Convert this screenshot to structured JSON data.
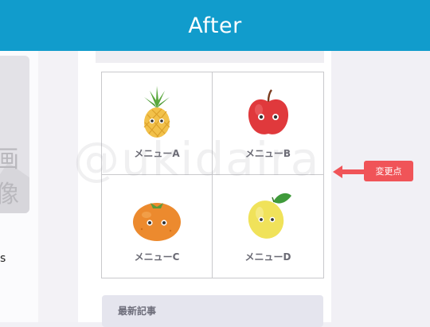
{
  "header": {
    "title": "After"
  },
  "left_panel": {
    "faded_text": "画像",
    "edge_text": "s"
  },
  "watermark": {
    "text": "@ukidaira"
  },
  "menu": {
    "items": [
      {
        "label": "メニューA",
        "icon": "pineapple-icon"
      },
      {
        "label": "メニューB",
        "icon": "apple-icon"
      },
      {
        "label": "メニューC",
        "icon": "orange-icon"
      },
      {
        "label": "メニューD",
        "icon": "lemon-icon"
      }
    ]
  },
  "callout": {
    "label": "変更点",
    "color": "#f05458"
  },
  "recent": {
    "title": "最新記事"
  },
  "colors": {
    "header_bg": "#119ccc",
    "accent": "#f05458"
  }
}
